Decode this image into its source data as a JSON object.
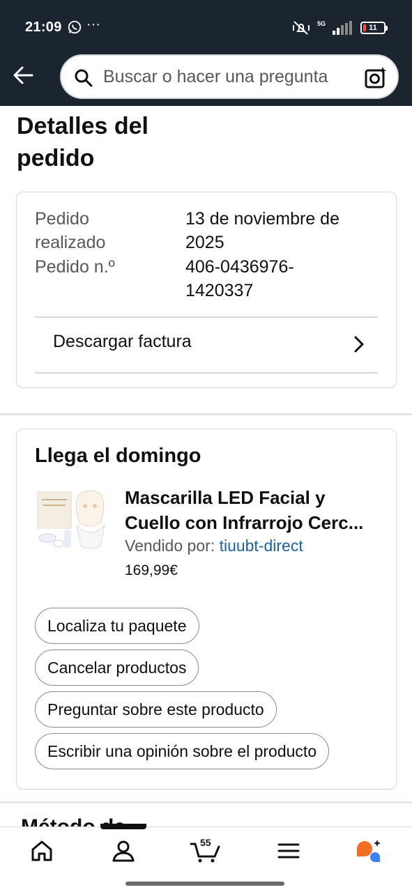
{
  "status_bar": {
    "time": "21:09",
    "dots": "···",
    "network_label_top": "5G",
    "battery": "11"
  },
  "search": {
    "placeholder": "Buscar o hacer una pregunta"
  },
  "page": {
    "title_line1": "Detalles del",
    "title_line2": "pedido"
  },
  "order": {
    "date_label_line1": "Pedido",
    "date_label_line2": "realizado",
    "date_value_line1": "13 de noviembre de",
    "date_value_line2": "2025",
    "number_label": "Pedido n.º",
    "number_value_line1": "406-0436976-",
    "number_value_line2": "1420337",
    "invoice_label": "Descargar factura"
  },
  "delivery": {
    "title": "Llega el domingo",
    "product": {
      "title_line1": "Mascarilla LED Facial y",
      "title_line2": "Cuello con Infrarrojo Cerc...",
      "sold_by_label": "Vendido por:",
      "seller": "tiuubt-direct",
      "price": "169,99€"
    },
    "buttons": [
      "Localiza tu paquete",
      "Cancelar productos",
      "Preguntar sobre este producto",
      "Escribir una opinión sobre el producto"
    ]
  },
  "next_section_partial": "Método de",
  "bottom_nav": {
    "cart_count": "55"
  },
  "colors": {
    "header_bg": "#1b2530",
    "link": "#2162a1",
    "ai_orange": "#f36f27",
    "ai_blue": "#3b82f6",
    "battery_low": "#ff4d4d"
  }
}
